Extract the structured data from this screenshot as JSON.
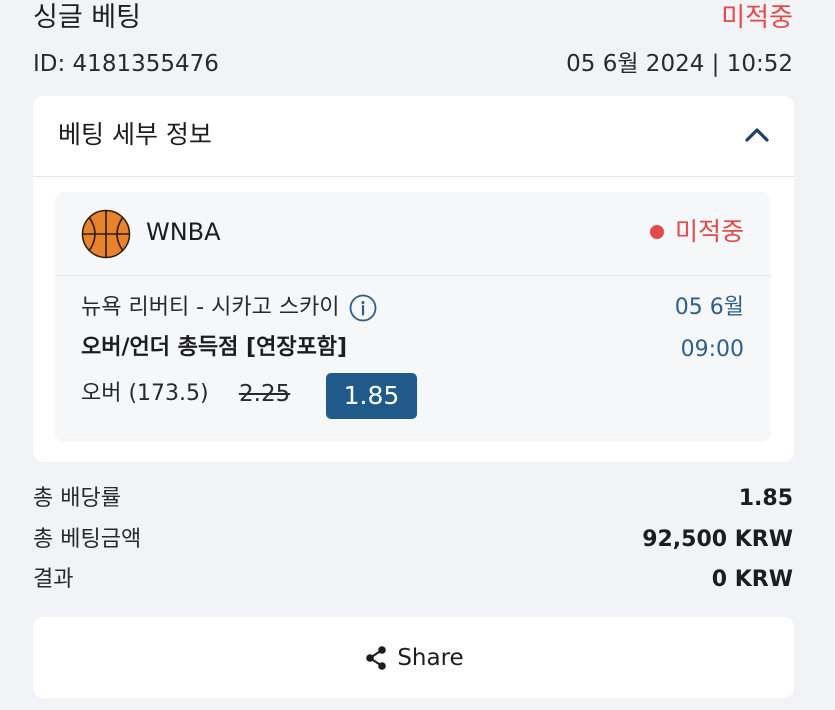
{
  "header": {
    "title": "싱글 베팅",
    "status": "미적중",
    "id_label": "ID: 4181355476",
    "date": "05 6월 2024 | 10:52"
  },
  "details": {
    "title": "베팅 세부 정보",
    "toggle_icon": "chevron-up-icon"
  },
  "selection": {
    "league": "WNBA",
    "sport_icon": "basketball-icon",
    "status": "미적중",
    "match": "뉴욕 리버티 - 시카고 스카이",
    "market": "오버/언더 총득점 [연장포함]",
    "pick": "오버 (173.5)",
    "old_odds": "2.25",
    "odds": "1.85",
    "event_date": "05 6월",
    "event_time": "09:00"
  },
  "summary": {
    "total_odds_label": "총 배당률",
    "total_odds": "1.85",
    "stake_label": "총 베팅금액",
    "stake": "92,500 KRW",
    "result_label": "결과",
    "result": "0 KRW"
  },
  "share": {
    "label": "Share",
    "icon": "share-icon"
  },
  "colors": {
    "loss": "#e14b4b",
    "accent": "#1f5a8a",
    "time": "#2e5f8a",
    "background": "#f1f3f6"
  }
}
